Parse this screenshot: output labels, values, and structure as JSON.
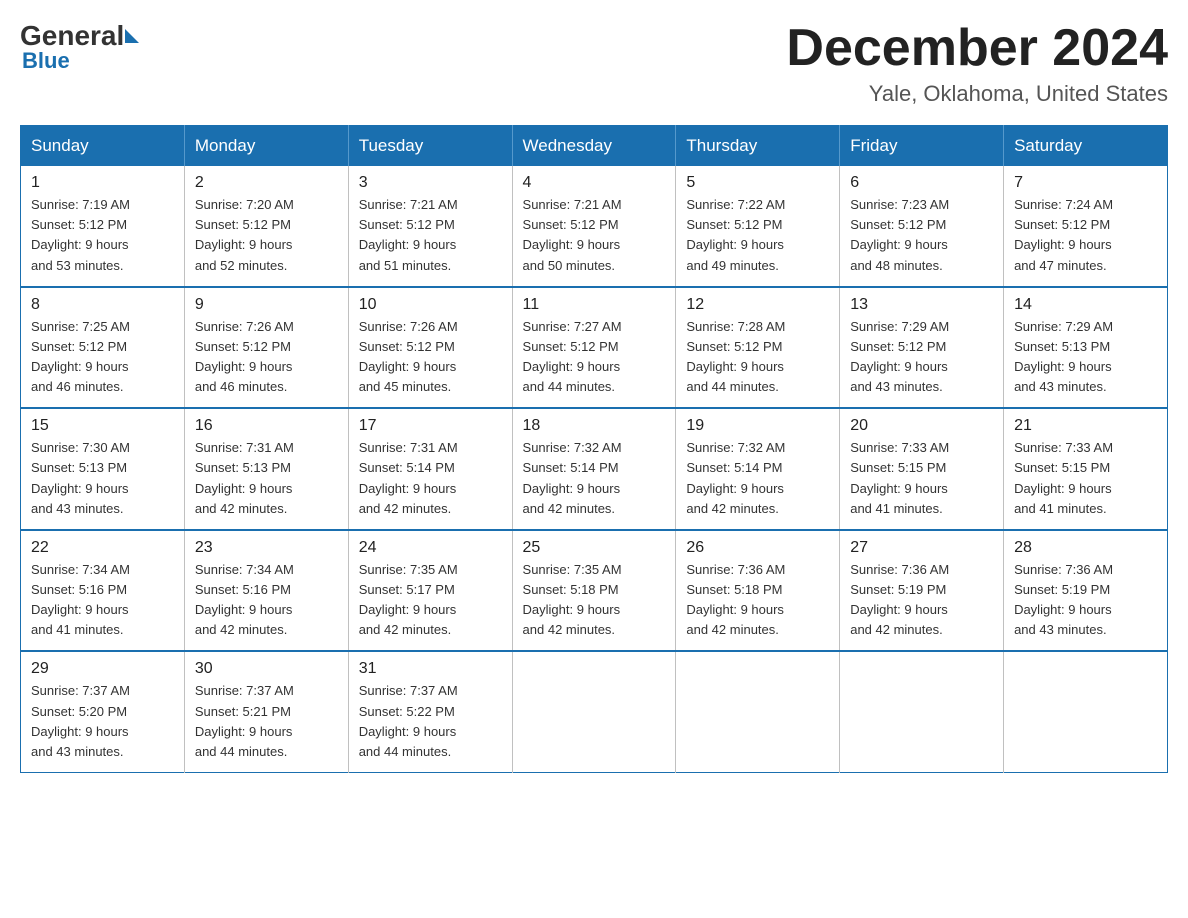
{
  "logo": {
    "general": "General",
    "blue": "Blue"
  },
  "header": {
    "month": "December 2024",
    "location": "Yale, Oklahoma, United States"
  },
  "weekdays": [
    "Sunday",
    "Monday",
    "Tuesday",
    "Wednesday",
    "Thursday",
    "Friday",
    "Saturday"
  ],
  "weeks": [
    [
      {
        "day": "1",
        "sunrise": "7:19 AM",
        "sunset": "5:12 PM",
        "daylight": "9 hours and 53 minutes."
      },
      {
        "day": "2",
        "sunrise": "7:20 AM",
        "sunset": "5:12 PM",
        "daylight": "9 hours and 52 minutes."
      },
      {
        "day": "3",
        "sunrise": "7:21 AM",
        "sunset": "5:12 PM",
        "daylight": "9 hours and 51 minutes."
      },
      {
        "day": "4",
        "sunrise": "7:21 AM",
        "sunset": "5:12 PM",
        "daylight": "9 hours and 50 minutes."
      },
      {
        "day": "5",
        "sunrise": "7:22 AM",
        "sunset": "5:12 PM",
        "daylight": "9 hours and 49 minutes."
      },
      {
        "day": "6",
        "sunrise": "7:23 AM",
        "sunset": "5:12 PM",
        "daylight": "9 hours and 48 minutes."
      },
      {
        "day": "7",
        "sunrise": "7:24 AM",
        "sunset": "5:12 PM",
        "daylight": "9 hours and 47 minutes."
      }
    ],
    [
      {
        "day": "8",
        "sunrise": "7:25 AM",
        "sunset": "5:12 PM",
        "daylight": "9 hours and 46 minutes."
      },
      {
        "day": "9",
        "sunrise": "7:26 AM",
        "sunset": "5:12 PM",
        "daylight": "9 hours and 46 minutes."
      },
      {
        "day": "10",
        "sunrise": "7:26 AM",
        "sunset": "5:12 PM",
        "daylight": "9 hours and 45 minutes."
      },
      {
        "day": "11",
        "sunrise": "7:27 AM",
        "sunset": "5:12 PM",
        "daylight": "9 hours and 44 minutes."
      },
      {
        "day": "12",
        "sunrise": "7:28 AM",
        "sunset": "5:12 PM",
        "daylight": "9 hours and 44 minutes."
      },
      {
        "day": "13",
        "sunrise": "7:29 AM",
        "sunset": "5:12 PM",
        "daylight": "9 hours and 43 minutes."
      },
      {
        "day": "14",
        "sunrise": "7:29 AM",
        "sunset": "5:13 PM",
        "daylight": "9 hours and 43 minutes."
      }
    ],
    [
      {
        "day": "15",
        "sunrise": "7:30 AM",
        "sunset": "5:13 PM",
        "daylight": "9 hours and 43 minutes."
      },
      {
        "day": "16",
        "sunrise": "7:31 AM",
        "sunset": "5:13 PM",
        "daylight": "9 hours and 42 minutes."
      },
      {
        "day": "17",
        "sunrise": "7:31 AM",
        "sunset": "5:14 PM",
        "daylight": "9 hours and 42 minutes."
      },
      {
        "day": "18",
        "sunrise": "7:32 AM",
        "sunset": "5:14 PM",
        "daylight": "9 hours and 42 minutes."
      },
      {
        "day": "19",
        "sunrise": "7:32 AM",
        "sunset": "5:14 PM",
        "daylight": "9 hours and 42 minutes."
      },
      {
        "day": "20",
        "sunrise": "7:33 AM",
        "sunset": "5:15 PM",
        "daylight": "9 hours and 41 minutes."
      },
      {
        "day": "21",
        "sunrise": "7:33 AM",
        "sunset": "5:15 PM",
        "daylight": "9 hours and 41 minutes."
      }
    ],
    [
      {
        "day": "22",
        "sunrise": "7:34 AM",
        "sunset": "5:16 PM",
        "daylight": "9 hours and 41 minutes."
      },
      {
        "day": "23",
        "sunrise": "7:34 AM",
        "sunset": "5:16 PM",
        "daylight": "9 hours and 42 minutes."
      },
      {
        "day": "24",
        "sunrise": "7:35 AM",
        "sunset": "5:17 PM",
        "daylight": "9 hours and 42 minutes."
      },
      {
        "day": "25",
        "sunrise": "7:35 AM",
        "sunset": "5:18 PM",
        "daylight": "9 hours and 42 minutes."
      },
      {
        "day": "26",
        "sunrise": "7:36 AM",
        "sunset": "5:18 PM",
        "daylight": "9 hours and 42 minutes."
      },
      {
        "day": "27",
        "sunrise": "7:36 AM",
        "sunset": "5:19 PM",
        "daylight": "9 hours and 42 minutes."
      },
      {
        "day": "28",
        "sunrise": "7:36 AM",
        "sunset": "5:19 PM",
        "daylight": "9 hours and 43 minutes."
      }
    ],
    [
      {
        "day": "29",
        "sunrise": "7:37 AM",
        "sunset": "5:20 PM",
        "daylight": "9 hours and 43 minutes."
      },
      {
        "day": "30",
        "sunrise": "7:37 AM",
        "sunset": "5:21 PM",
        "daylight": "9 hours and 44 minutes."
      },
      {
        "day": "31",
        "sunrise": "7:37 AM",
        "sunset": "5:22 PM",
        "daylight": "9 hours and 44 minutes."
      },
      null,
      null,
      null,
      null
    ]
  ],
  "labels": {
    "sunrise": "Sunrise:",
    "sunset": "Sunset:",
    "daylight": "Daylight:"
  }
}
